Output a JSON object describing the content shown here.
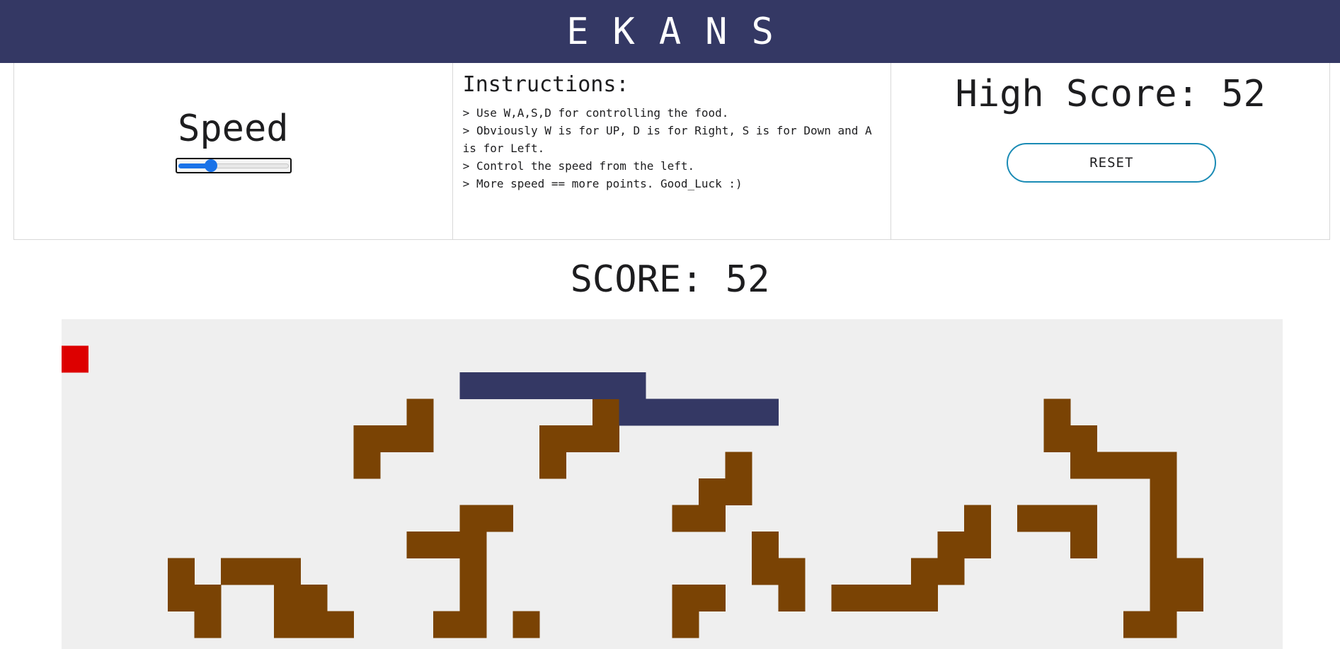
{
  "header": {
    "title": "EKANS"
  },
  "speed": {
    "label": "Speed",
    "value": 0.28
  },
  "instructions": {
    "title": "Instructions:",
    "lines": [
      "> Use W,A,S,D for controlling the food.",
      "> Obviously W is for UP, D is for Right, S is for Down and A is for Left.",
      "> Control the speed from the left.",
      "> More speed == more points. Good_Luck :)"
    ]
  },
  "high_score": {
    "label": "High Score: ",
    "value": "52"
  },
  "reset": {
    "label": "RESET"
  },
  "score": {
    "label": "SCORE: ",
    "value": "52"
  },
  "colors": {
    "header_bg": "#343864",
    "board_bg": "#efefef",
    "snake": "#343864",
    "food": "#dd0000",
    "walls": "#7a4304",
    "slider": "#1a73e8",
    "reset_border": "#1a8bb5"
  },
  "board": {
    "food": [
      [
        0,
        1
      ]
    ],
    "snake": [
      [
        15,
        2
      ],
      [
        16,
        2
      ],
      [
        17,
        2
      ],
      [
        18,
        2
      ],
      [
        19,
        2
      ],
      [
        20,
        2
      ],
      [
        21,
        2
      ],
      [
        21,
        3
      ],
      [
        22,
        3
      ],
      [
        23,
        3
      ],
      [
        24,
        3
      ],
      [
        25,
        3
      ],
      [
        26,
        3
      ]
    ],
    "walls": [
      [
        13,
        3
      ],
      [
        11,
        4
      ],
      [
        12,
        4
      ],
      [
        13,
        4
      ],
      [
        11,
        5
      ],
      [
        20,
        3
      ],
      [
        18,
        4
      ],
      [
        19,
        4
      ],
      [
        20,
        4
      ],
      [
        18,
        5
      ],
      [
        25,
        5
      ],
      [
        24,
        6
      ],
      [
        25,
        6
      ],
      [
        23,
        7
      ],
      [
        24,
        7
      ],
      [
        15,
        7
      ],
      [
        16,
        7
      ],
      [
        13,
        8
      ],
      [
        14,
        8
      ],
      [
        15,
        8
      ],
      [
        15,
        9
      ],
      [
        15,
        10
      ],
      [
        15,
        11
      ],
      [
        14,
        11
      ],
      [
        17,
        11
      ],
      [
        4,
        9
      ],
      [
        4,
        10
      ],
      [
        5,
        10
      ],
      [
        6,
        9
      ],
      [
        7,
        9
      ],
      [
        8,
        9
      ],
      [
        8,
        10
      ],
      [
        9,
        10
      ],
      [
        5,
        11
      ],
      [
        8,
        11
      ],
      [
        9,
        11
      ],
      [
        10,
        11
      ],
      [
        26,
        8
      ],
      [
        26,
        9
      ],
      [
        27,
        9
      ],
      [
        27,
        10
      ],
      [
        23,
        10
      ],
      [
        24,
        10
      ],
      [
        23,
        11
      ],
      [
        34,
        7
      ],
      [
        33,
        8
      ],
      [
        34,
        8
      ],
      [
        32,
        9
      ],
      [
        33,
        9
      ],
      [
        31,
        10
      ],
      [
        32,
        10
      ],
      [
        29,
        10
      ],
      [
        30,
        10
      ],
      [
        31,
        10
      ],
      [
        37,
        3
      ],
      [
        37,
        4
      ],
      [
        38,
        4
      ],
      [
        38,
        5
      ],
      [
        39,
        5
      ],
      [
        40,
        5
      ],
      [
        41,
        5
      ],
      [
        41,
        6
      ],
      [
        41,
        7
      ],
      [
        41,
        8
      ],
      [
        41,
        9
      ],
      [
        41,
        10
      ],
      [
        42,
        10
      ],
      [
        41,
        11
      ],
      [
        40,
        11
      ],
      [
        42,
        9
      ],
      [
        36,
        7
      ],
      [
        37,
        7
      ],
      [
        38,
        7
      ],
      [
        38,
        8
      ]
    ]
  }
}
